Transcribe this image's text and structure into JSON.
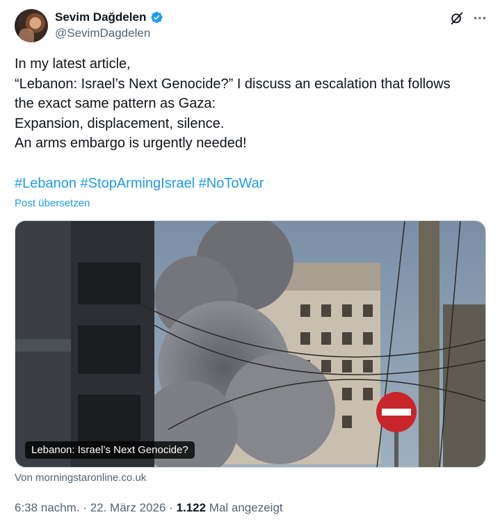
{
  "author": {
    "display_name": "Sevim Dağdelen",
    "handle": "@SevimDagdelen",
    "verified": true,
    "verified_color": "#1d9bf0"
  },
  "tweet": {
    "lines": [
      "In my latest article,",
      "“Lebanon: Israel’s Next Genocide?” I discuss an escalation that follows",
      "the exact same pattern as Gaza:",
      "Expansion, displacement, silence.",
      "An arms embargo is urgently needed!"
    ],
    "hashtags": [
      "#Lebanon",
      "#StopArmingIsrael",
      "#NoToWar"
    ],
    "translate_label": "Post übersetzen"
  },
  "card": {
    "caption": "Lebanon: Israel’s Next Genocide?",
    "source": "Von morningstaronline.co.uk"
  },
  "meta": {
    "time": "6:38 nachm.",
    "date": "22. März 2026",
    "views_count": "1.122",
    "views_label": "Mal angezeigt"
  },
  "icons": {
    "grok": "grok-icon",
    "more": "more-options-icon",
    "verified": "verified-badge-icon"
  },
  "colors": {
    "link": "#1d9bf0",
    "text": "#0f1419",
    "secondary": "#536471"
  }
}
